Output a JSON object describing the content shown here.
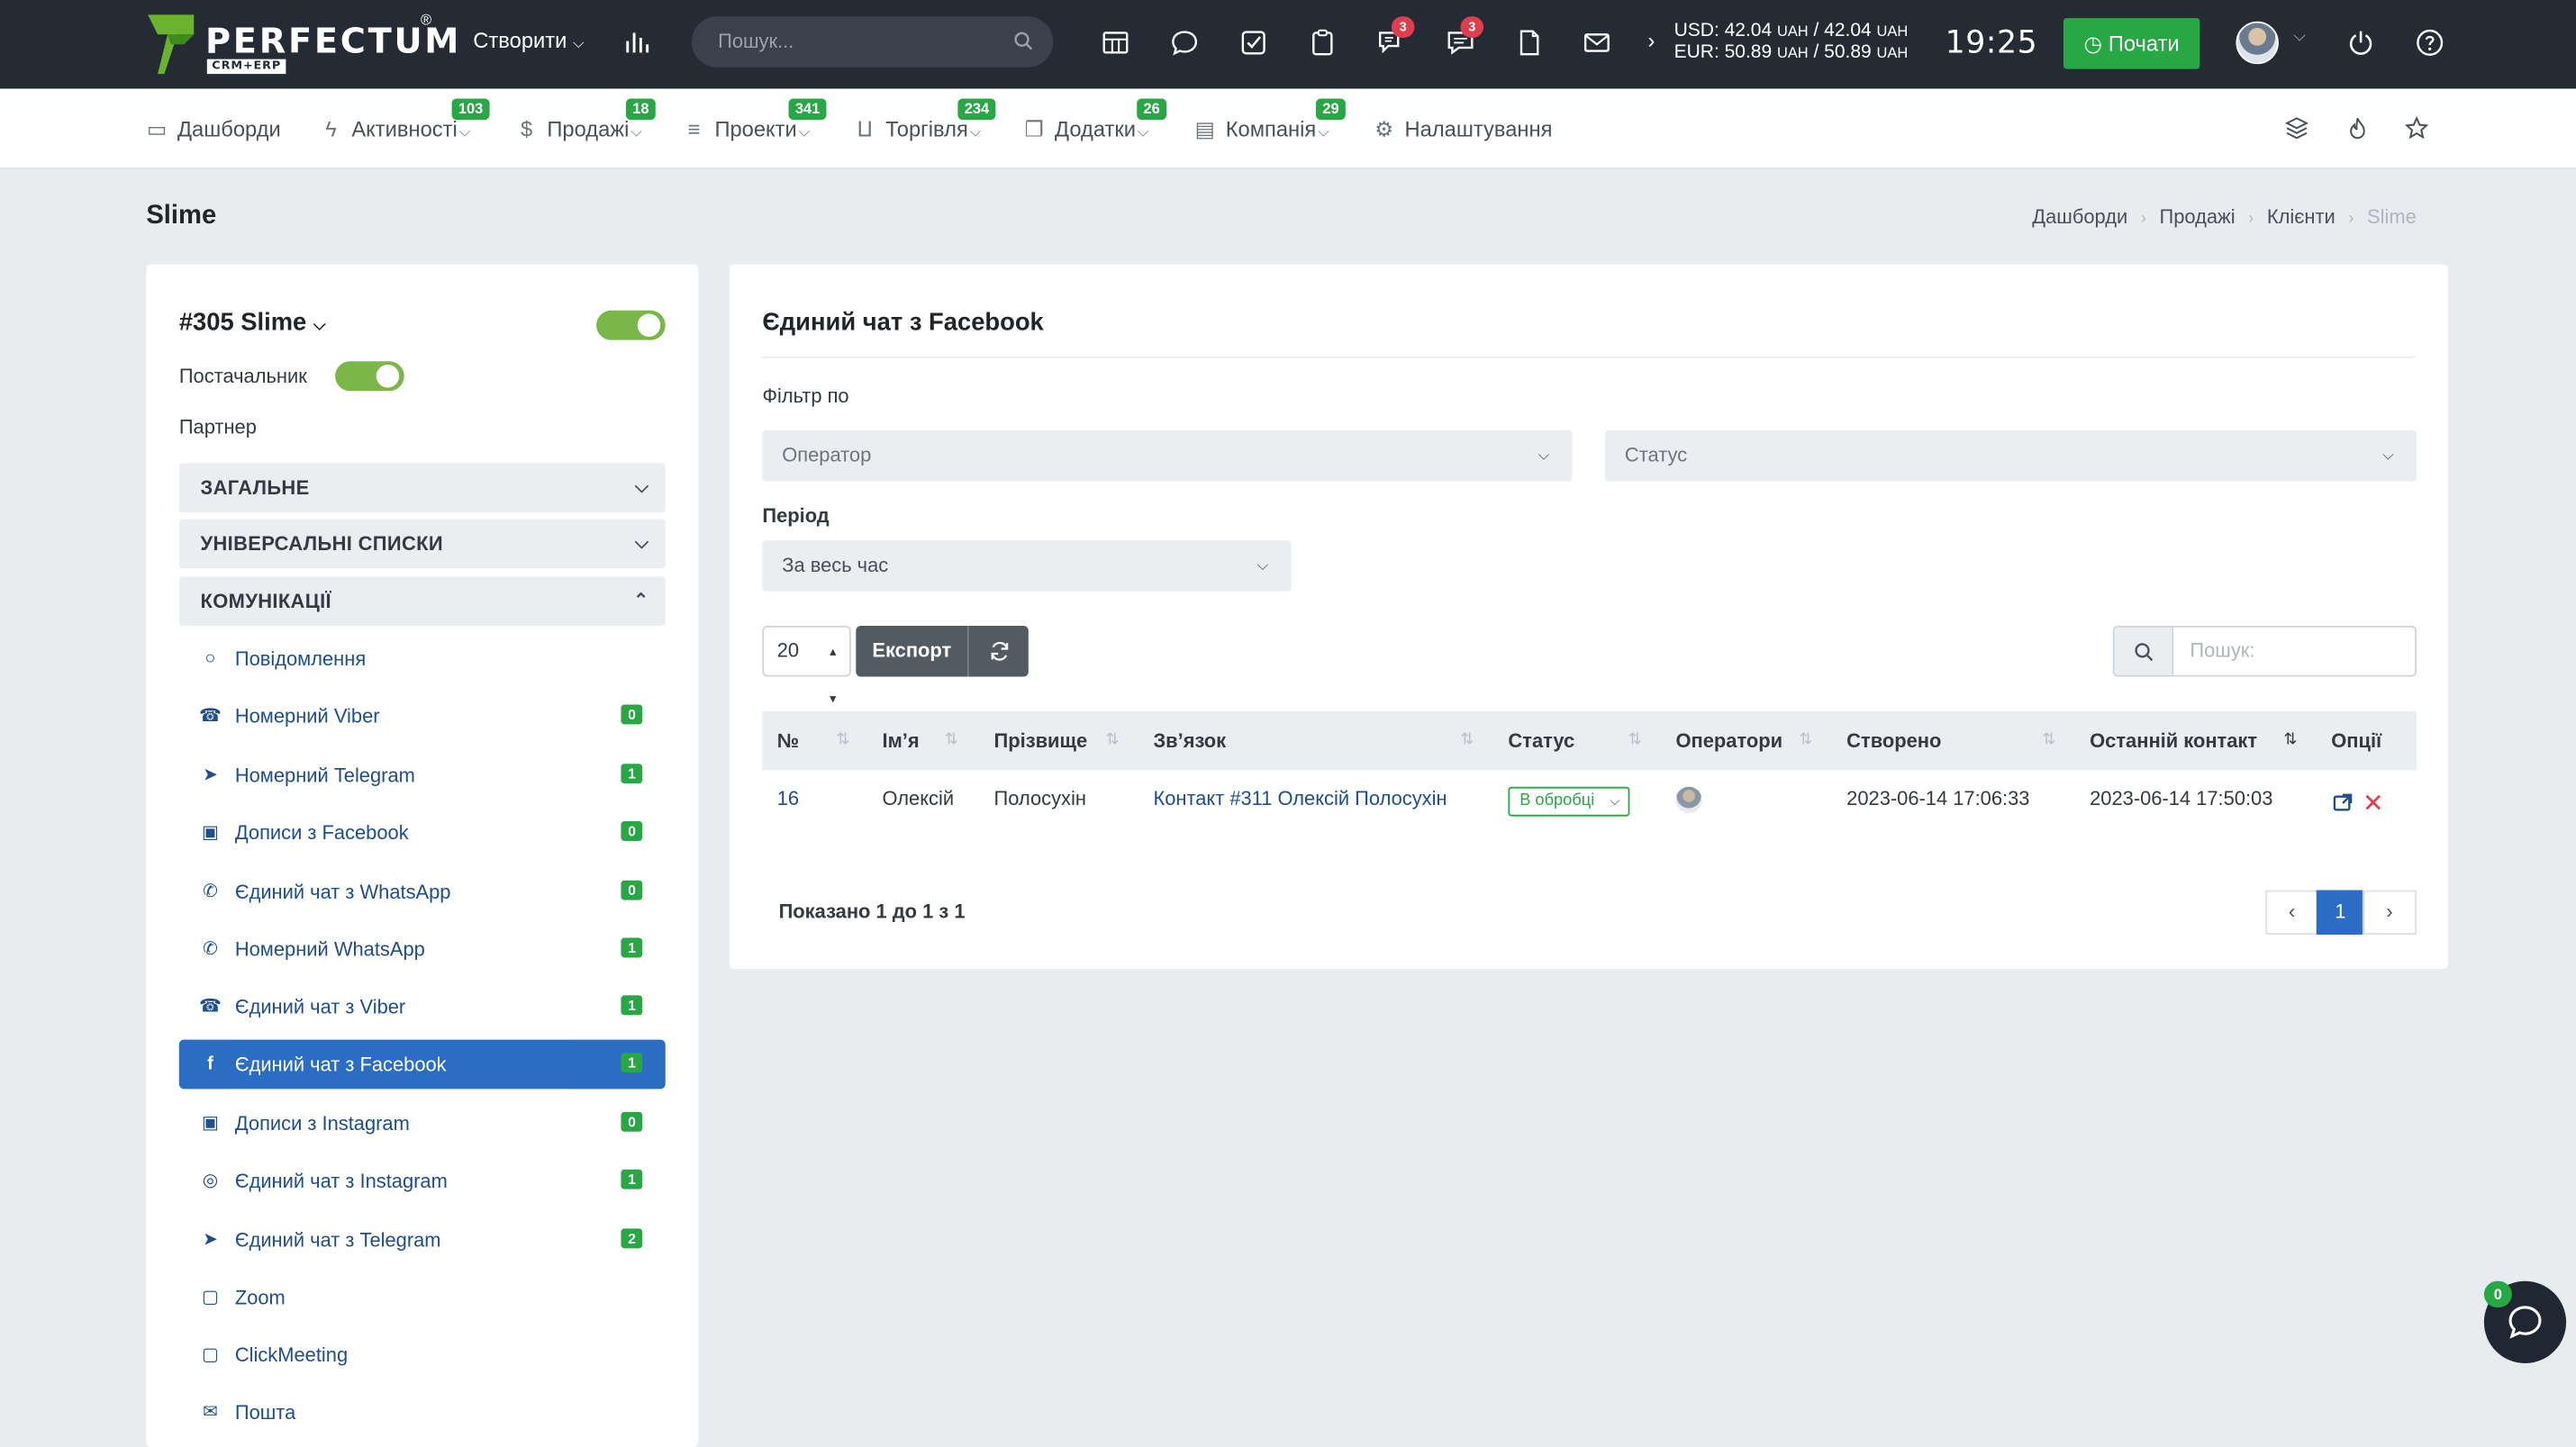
{
  "header": {
    "logo_text": "PERFECTUM",
    "logo_sub": "CRM+ERP",
    "logo_reg": "®",
    "create_label": "Створити",
    "search_placeholder": "Пошук...",
    "badges": {
      "chat_a": "3",
      "chat_b": "3"
    },
    "rates": {
      "usd_label": "USD:",
      "usd_value": "42.04",
      "usd_unit": "UAH",
      "usd_sep": "/",
      "usd_value2": "42.04",
      "usd_unit2": "UAH",
      "eur_label": "EUR:",
      "eur_value": "50.89",
      "eur_unit": "UAH",
      "eur_sep": "/",
      "eur_value2": "50.89",
      "eur_unit2": "UAH"
    },
    "clock": "19:25",
    "start_label": "Почати"
  },
  "nav": {
    "items": [
      {
        "label": "Дашборди",
        "icon": "monitor-icon"
      },
      {
        "label": "Активності",
        "badge": "103",
        "icon": "bolt-icon"
      },
      {
        "label": "Продажі",
        "badge": "18",
        "icon": "dollar-icon"
      },
      {
        "label": "Проекти",
        "badge": "341",
        "icon": "layers-icon"
      },
      {
        "label": "Торгівля",
        "badge": "234",
        "icon": "cart-icon"
      },
      {
        "label": "Додатки",
        "badge": "26",
        "icon": "copy-icon"
      },
      {
        "label": "Компанія",
        "badge": "29",
        "icon": "briefcase-icon"
      },
      {
        "label": "Налаштування",
        "icon": "gear-icon"
      }
    ]
  },
  "page": {
    "title": "Slime",
    "breadcrumb": [
      "Дашборди",
      "Продажі",
      "Клієнти",
      "Slime"
    ]
  },
  "client": {
    "name": "#305 Slime",
    "supplier_label": "Постачальник",
    "partner_label": "Партнер",
    "sections": [
      "ЗАГАЛЬНЕ",
      "УНІВЕРСАЛЬНІ СПИСКИ",
      "КОМУНІКАЦІЇ"
    ],
    "menu": [
      {
        "label": "Повідомлення",
        "icon": "chat-icon"
      },
      {
        "label": "Номерний Viber",
        "badge": "0",
        "icon": "viber-icon"
      },
      {
        "label": "Номерний Telegram",
        "badge": "1",
        "icon": "telegram-icon"
      },
      {
        "label": "Дописи з Facebook",
        "badge": "0",
        "icon": "posts-icon"
      },
      {
        "label": "Єдиний чат з WhatsApp",
        "badge": "0",
        "icon": "whatsapp-icon"
      },
      {
        "label": "Номерний WhatsApp",
        "badge": "1",
        "icon": "whatsapp-icon"
      },
      {
        "label": "Єдиний чат з Viber",
        "badge": "1",
        "icon": "viber-icon"
      },
      {
        "label": "Єдиний чат з Facebook",
        "badge": "1",
        "icon": "facebook-icon",
        "active": true
      },
      {
        "label": "Дописи з Instagram",
        "badge": "0",
        "icon": "posts-icon"
      },
      {
        "label": "Єдиний чат з Instagram",
        "badge": "1",
        "icon": "instagram-icon"
      },
      {
        "label": "Єдиний чат з Telegram",
        "badge": "2",
        "icon": "telegram-icon"
      },
      {
        "label": "Zoom",
        "icon": "video-icon"
      },
      {
        "label": "ClickMeeting",
        "icon": "video-icon"
      },
      {
        "label": "Пошта",
        "icon": "mail-icon"
      }
    ]
  },
  "panel": {
    "title": "Єдиний чат з Facebook",
    "filter_label": "Фільтр по",
    "operator_placeholder": "Оператор",
    "status_placeholder": "Статус",
    "period_label": "Період",
    "period_value": "За весь час",
    "page_length": "20",
    "export_label": "Експорт",
    "search_placeholder": "Пошук:",
    "columns": [
      "№",
      "Ім’я",
      "Прізвище",
      "Зв’язок",
      "Статус",
      "Оператори",
      "Створено",
      "Останній контакт",
      "Опції"
    ],
    "rows": [
      {
        "num": "16",
        "first": "Олексій",
        "last": "Полосухін",
        "contact": "Контакт #311 Олексій Полосухін",
        "status": "В обробці",
        "created": "2023-06-14 17:06:33",
        "last_contact": "2023-06-14 17:50:03"
      }
    ],
    "shown": "Показано 1 до 1 з 1",
    "page": "1"
  },
  "chat_widget": {
    "badge": "0"
  },
  "colors": {
    "topbar": "#252b35",
    "accent_green": "#28a745",
    "active_blue": "#2b6cc4",
    "link": "#1f4e8c",
    "toggle": "#7ab648"
  }
}
